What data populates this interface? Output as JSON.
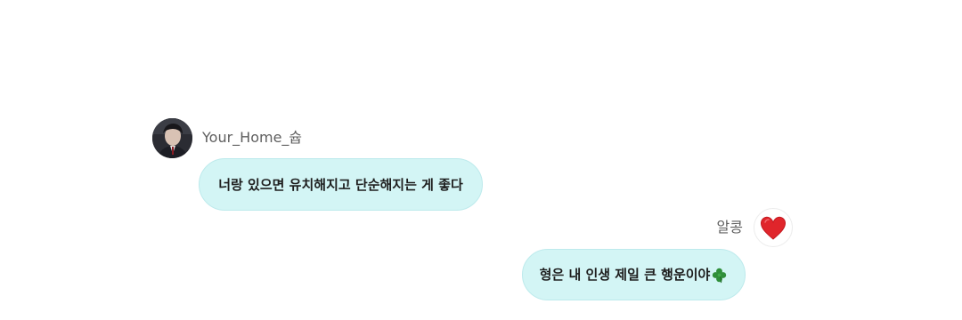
{
  "messages": [
    {
      "direction": "incoming",
      "sender": "Your_Home_슙",
      "text": "너랑 있으면 유치해지고 단순해지는 게 좋다",
      "avatar_icon": "profile-photo"
    },
    {
      "direction": "outgoing",
      "sender": "알콩",
      "text": "형은 내 인생 제일 큰 행운이야",
      "emoji": "four-leaf-clover",
      "avatar_icon": "red-heart-icon"
    }
  ],
  "colors": {
    "bubble": "#d3f5f5",
    "bubble_border": "#bdeaec",
    "sender_text": "#5f5f5f",
    "message_text": "#1e1e1e",
    "heart": "#e0252b",
    "clover": "#2f8f3a"
  }
}
